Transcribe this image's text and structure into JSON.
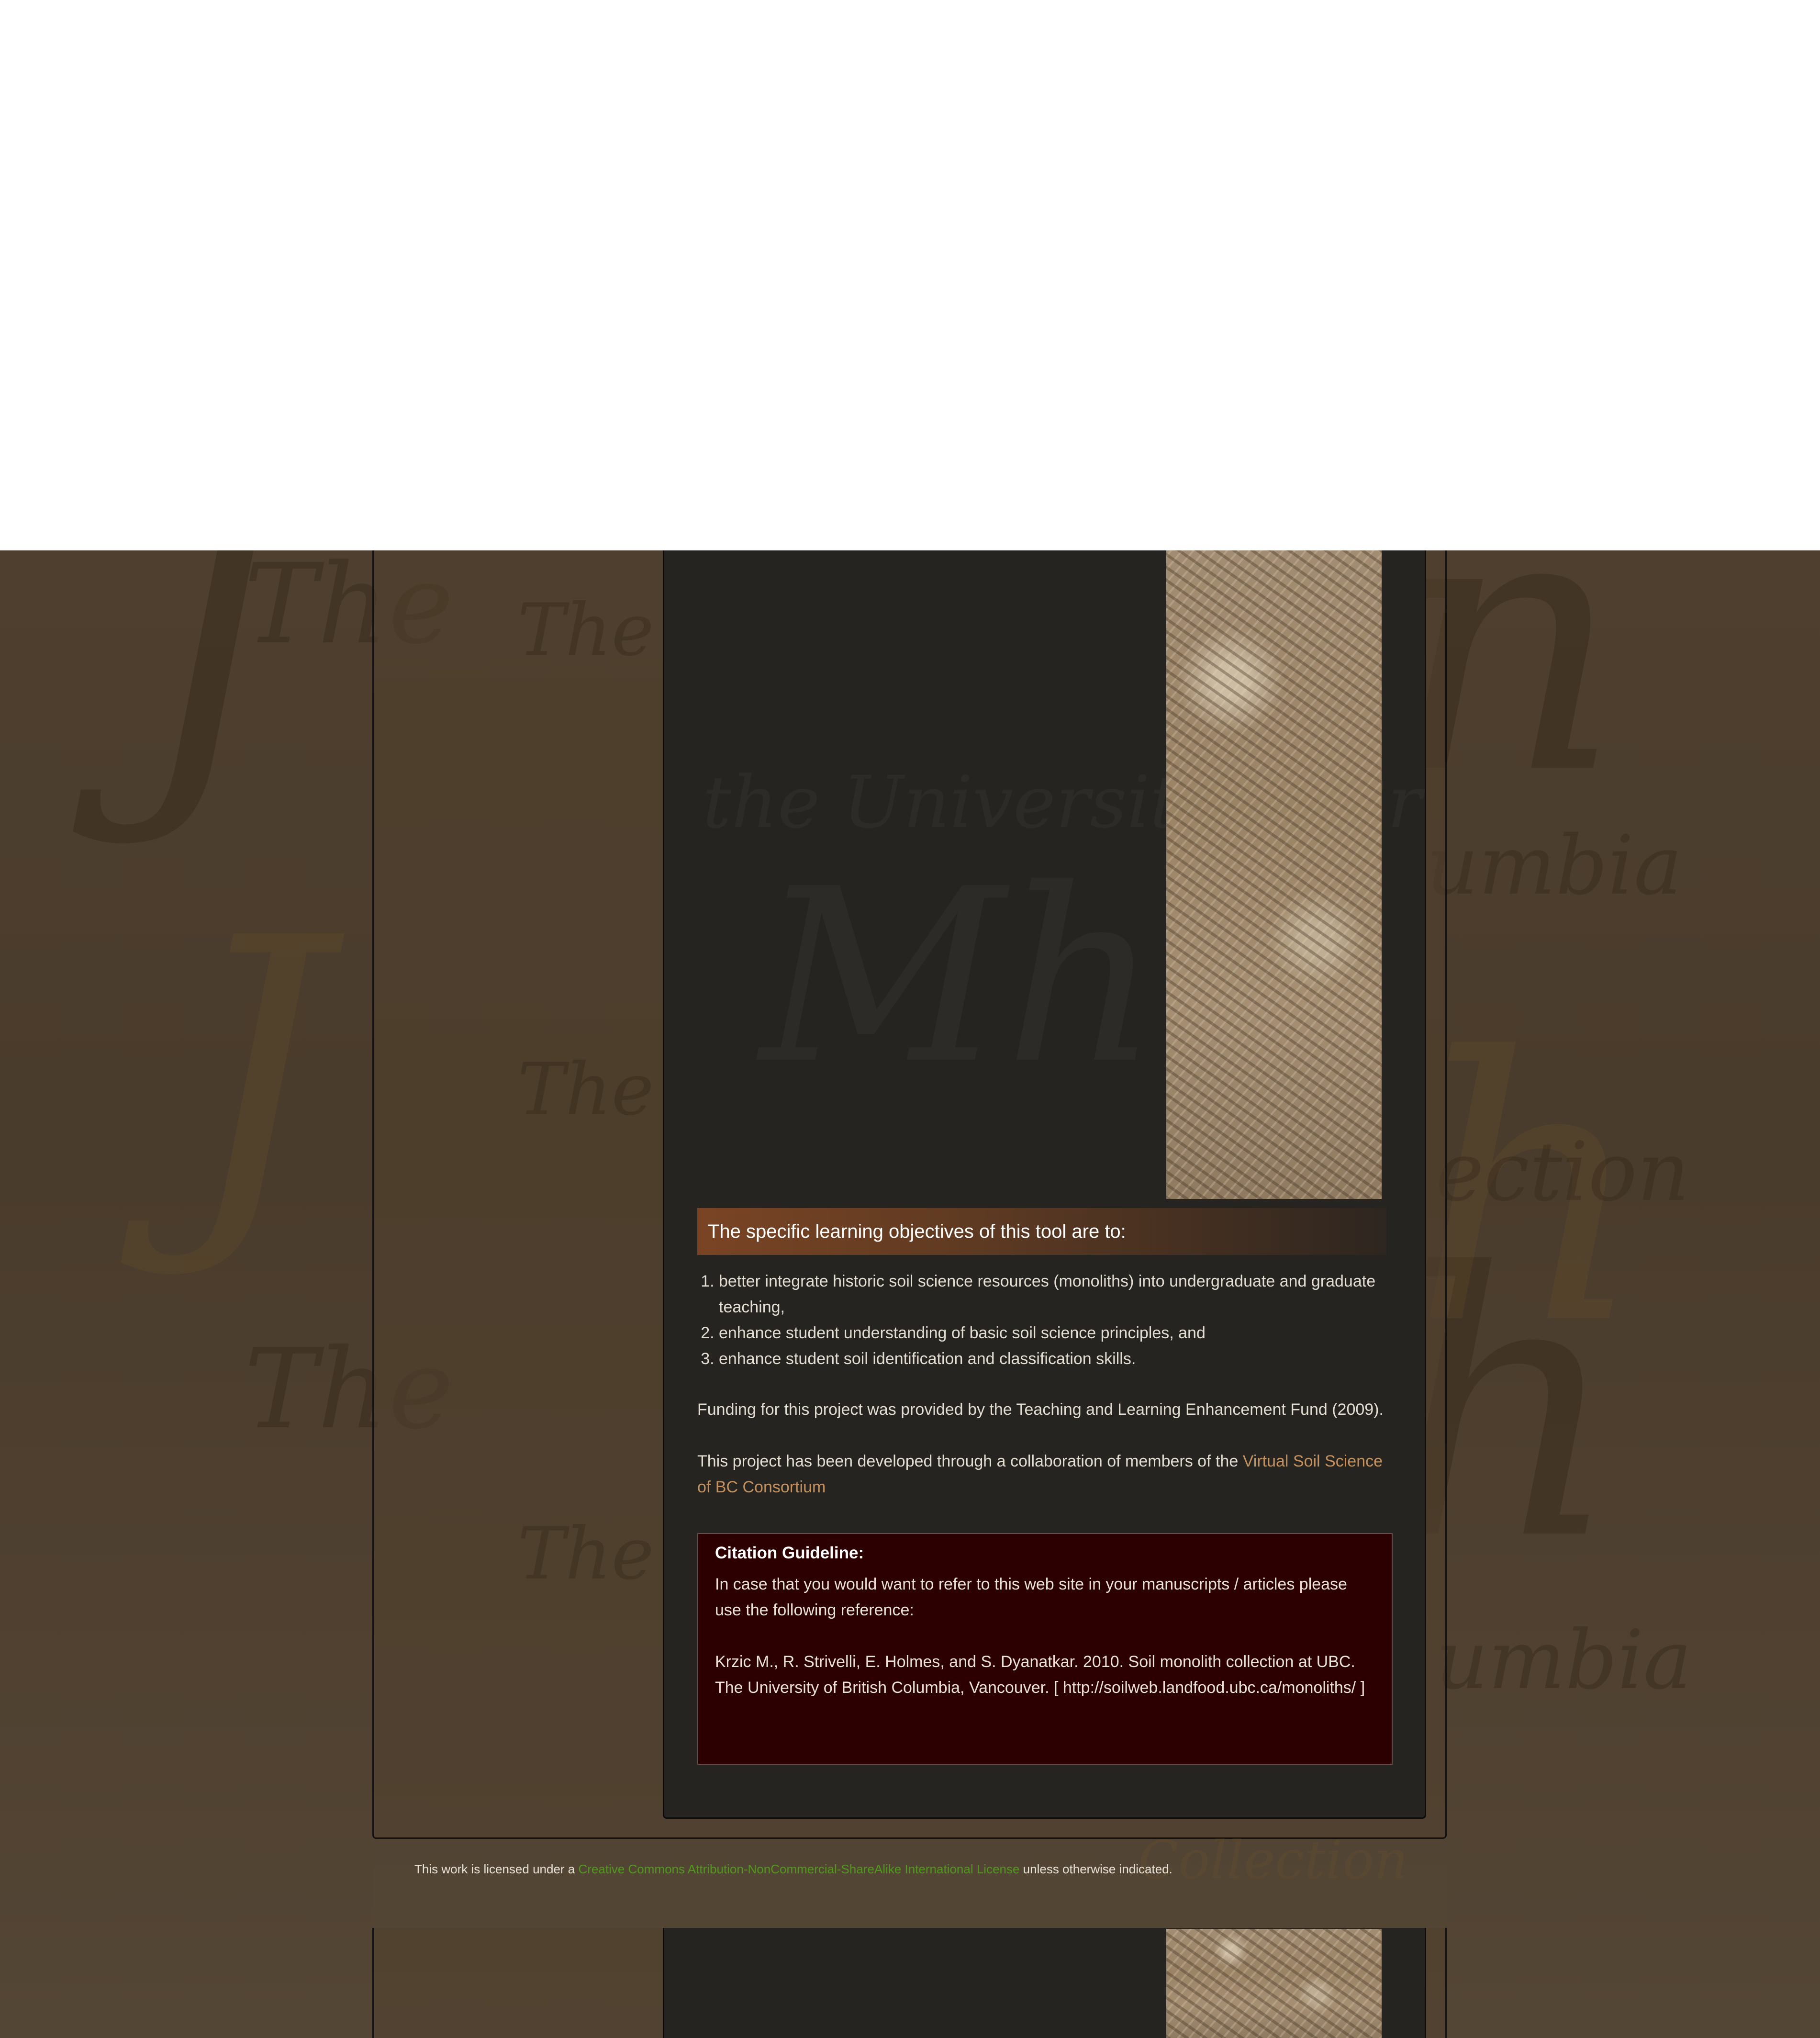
{
  "objectives": {
    "heading": "The specific learning objectives of this tool are to:",
    "items": [
      "better integrate historic soil science resources (monoliths) into undergraduate and graduate teaching,",
      "enhance student understanding of basic soil science principles, and",
      "enhance student soil identification and classification skills."
    ]
  },
  "funding": "Funding for this project was provided by the Teaching and Learning Enhancement Fund (2009).",
  "collaboration": {
    "text": "This project has been developed through a collaboration of members of the ",
    "link": "Virtual Soil Science of BC Consortium"
  },
  "citation": {
    "title": "Citation Guideline:",
    "intro": "In case that you would want to refer to this web site in your manuscripts / articles please use the following reference:",
    "reference": "Krzic M., R. Strivelli, E. Holmes, and S. Dyanatkar. 2010. Soil monolith collection at UBC. The University of British Columbia, Vancouver. [ http://soilweb.landfood.ubc.ca/monoliths/ ]"
  },
  "footer": {
    "prefix": "This work is licensed under a ",
    "license_link": "Creative Commons Attribution-NonCommercial-ShareAlike International License",
    "suffix": " unless otherwise indicated."
  },
  "colors": {
    "page_background": "#4e3f2f",
    "content_panel": "#262420",
    "header_accent": "#7a4424",
    "citation_box": "#2d0000",
    "link_brown": "#c4915e",
    "link_green": "#4f9a1c"
  }
}
